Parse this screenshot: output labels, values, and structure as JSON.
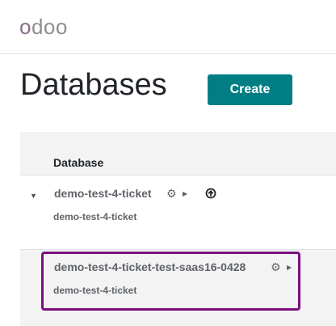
{
  "logo": {
    "first_letter": "o",
    "rest": "doo"
  },
  "page": {
    "title": "Databases"
  },
  "toolbar": {
    "create_label": "Create"
  },
  "table": {
    "column_header": "Database",
    "rows": [
      {
        "name": "demo-test-4-ticket",
        "sub": "demo-test-4-ticket",
        "expanded": true
      },
      {
        "name": "demo-test-4-ticket-test-saas16-0428",
        "sub": "demo-test-4-ticket",
        "highlighted": true
      }
    ]
  },
  "icons": {
    "caret": "caret-down-icon",
    "gear": "gear-icon",
    "dropdown": "triangle-right-icon",
    "upload": "upload-circle-icon"
  },
  "colors": {
    "brand": "#017e84",
    "highlight": "#7b0f7e",
    "logo_o": "#8f6a8a"
  }
}
